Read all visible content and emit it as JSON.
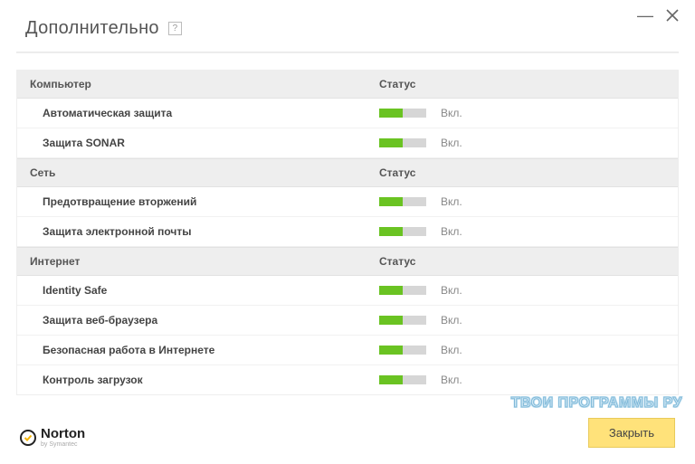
{
  "header": {
    "title": "Дополнительно",
    "help_glyph": "?"
  },
  "columns": {
    "status_header": "Статус"
  },
  "sections": [
    {
      "title": "Компьютер",
      "items": [
        {
          "name": "Автоматическая защита",
          "status": "Вкл."
        },
        {
          "name": "Защита SONAR",
          "status": "Вкл."
        }
      ]
    },
    {
      "title": "Сеть",
      "items": [
        {
          "name": "Предотвращение вторжений",
          "status": "Вкл."
        },
        {
          "name": "Защита электронной почты",
          "status": "Вкл."
        }
      ]
    },
    {
      "title": "Интернет",
      "items": [
        {
          "name": "Identity Safe",
          "status": "Вкл."
        },
        {
          "name": "Защита веб-браузера",
          "status": "Вкл."
        },
        {
          "name": "Безопасная работа в Интернете",
          "status": "Вкл."
        },
        {
          "name": "Контроль загрузок",
          "status": "Вкл."
        }
      ]
    }
  ],
  "footer": {
    "logo_name": "Norton",
    "logo_sub": "by Symantec",
    "close_label": "Закрыть"
  },
  "watermark": "ТВОИ ПРОГРАММЫ РУ",
  "colors": {
    "toggle_on": "#6ac322",
    "button_bg": "#ffe27a"
  }
}
